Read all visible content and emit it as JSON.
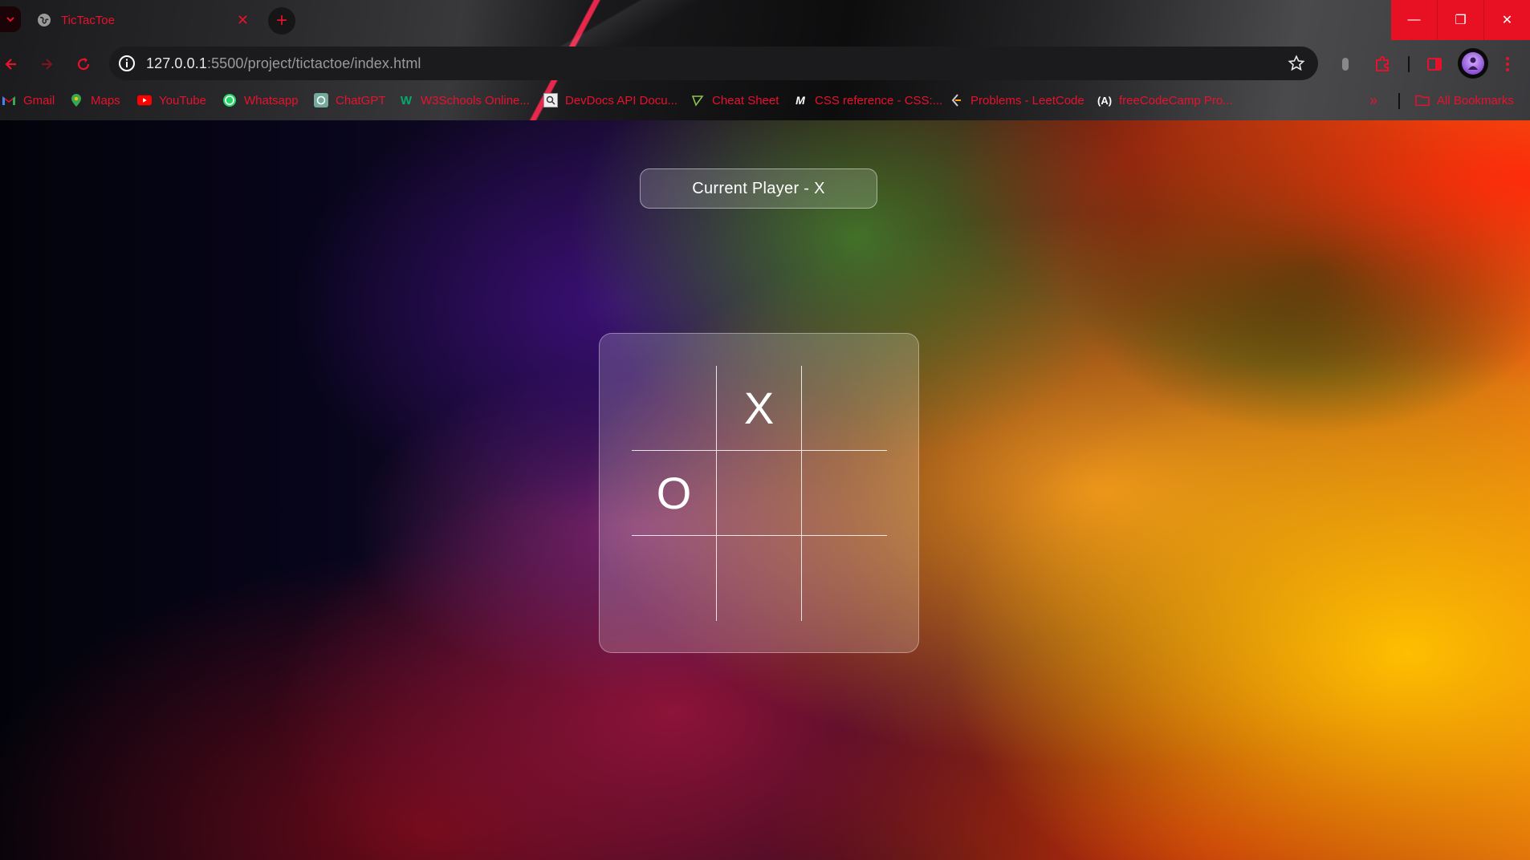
{
  "browser": {
    "tab_title": "TicTacToe",
    "new_tab_symbol": "+",
    "url_host": "127.0.0.1",
    "url_rest": ":5500/project/tictactoe/index.html",
    "window_controls": {
      "minimize": "—",
      "restore": "❐",
      "close": "✕"
    },
    "bookmarks": [
      {
        "label": "Gmail",
        "icon": "gmail-icon"
      },
      {
        "label": "Maps",
        "icon": "maps-icon"
      },
      {
        "label": "YouTube",
        "icon": "youtube-icon"
      },
      {
        "label": "Whatsapp",
        "icon": "whatsapp-icon"
      },
      {
        "label": "ChatGPT",
        "icon": "chatgpt-icon"
      },
      {
        "label": "W3Schools Online...",
        "icon": "w3schools-icon"
      },
      {
        "label": "DevDocs API Docu...",
        "icon": "devdocs-icon"
      },
      {
        "label": "Cheat Sheet",
        "icon": "cheat-sheet-icon"
      },
      {
        "label": "CSS reference - CSS:...",
        "icon": "mdn-icon"
      },
      {
        "label": "Problems - LeetCode",
        "icon": "leetcode-icon"
      },
      {
        "label": "freeCodeCamp Pro...",
        "icon": "freecodecamp-icon"
      }
    ],
    "overflow_label": "»",
    "all_bookmarks_label": "All Bookmarks",
    "accent_color": "#e8112d"
  },
  "game": {
    "status_text": "Current Player - X",
    "board": [
      "",
      "X",
      "",
      "O",
      "",
      "",
      "",
      "",
      ""
    ]
  }
}
